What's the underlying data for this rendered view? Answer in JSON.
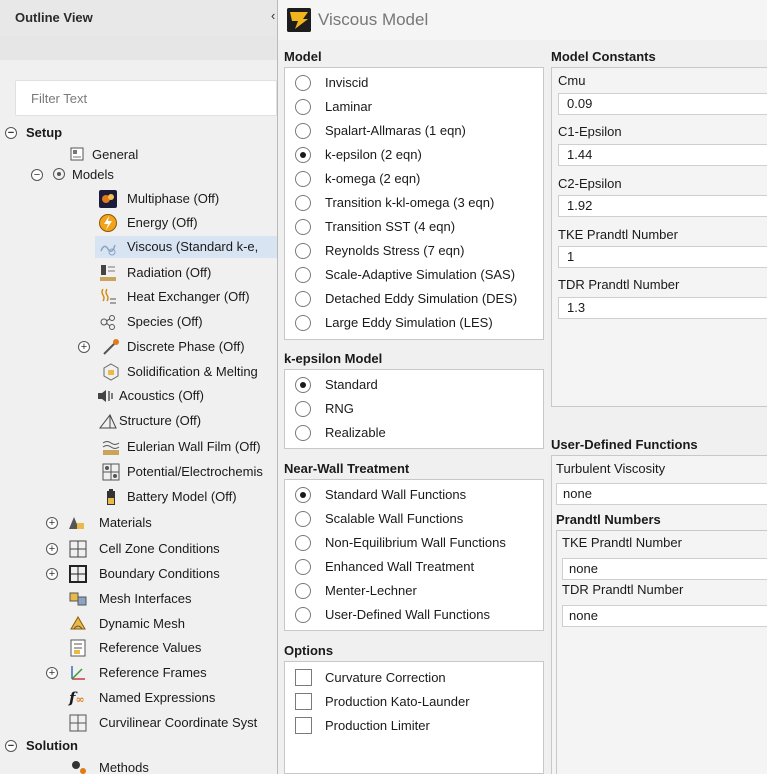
{
  "outline": {
    "title": "Outline View",
    "filter_placeholder": "Filter Text",
    "tree": {
      "setup": "Setup",
      "general": "General",
      "models": "Models",
      "multiphase": "Multiphase (Off)",
      "energy": "Energy (Off)",
      "viscous": "Viscous (Standard k-e,",
      "radiation": "Radiation (Off)",
      "heat_exchanger": "Heat Exchanger (Off)",
      "species": "Species (Off)",
      "discrete_phase": "Discrete Phase (Off)",
      "solidification": "Solidification & Melting",
      "acoustics": "Acoustics (Off)",
      "structure": "Structure (Off)",
      "eulerian": "Eulerian Wall Film (Off)",
      "potential": "Potential/Electrochemis",
      "battery": "Battery Model (Off)",
      "materials": "Materials",
      "cell_zone": "Cell Zone Conditions",
      "boundary": "Boundary Conditions",
      "mesh_interfaces": "Mesh Interfaces",
      "dynamic_mesh": "Dynamic Mesh",
      "reference_values": "Reference Values",
      "reference_frames": "Reference Frames",
      "named_expressions": "Named Expressions",
      "curvilinear": "Curvilinear Coordinate Syst",
      "solution": "Solution",
      "methods": "Methods"
    }
  },
  "dialog": {
    "title": "Viscous Model",
    "model": {
      "title": "Model",
      "options": [
        {
          "label": "Inviscid",
          "selected": false
        },
        {
          "label": "Laminar",
          "selected": false
        },
        {
          "label": "Spalart-Allmaras (1 eqn)",
          "selected": false
        },
        {
          "label": "k-epsilon (2 eqn)",
          "selected": true
        },
        {
          "label": "k-omega (2 eqn)",
          "selected": false
        },
        {
          "label": "Transition k-kl-omega (3 eqn)",
          "selected": false
        },
        {
          "label": "Transition SST (4 eqn)",
          "selected": false
        },
        {
          "label": "Reynolds Stress (7 eqn)",
          "selected": false
        },
        {
          "label": "Scale-Adaptive Simulation (SAS)",
          "selected": false
        },
        {
          "label": "Detached Eddy Simulation (DES)",
          "selected": false
        },
        {
          "label": "Large Eddy Simulation (LES)",
          "selected": false
        }
      ]
    },
    "kepsilon": {
      "title": "k-epsilon Model",
      "options": [
        {
          "label": "Standard",
          "selected": true
        },
        {
          "label": "RNG",
          "selected": false
        },
        {
          "label": "Realizable",
          "selected": false
        }
      ]
    },
    "nearwall": {
      "title": "Near-Wall Treatment",
      "options": [
        {
          "label": "Standard Wall Functions",
          "selected": true
        },
        {
          "label": "Scalable Wall Functions",
          "selected": false
        },
        {
          "label": "Non-Equilibrium Wall Functions",
          "selected": false
        },
        {
          "label": "Enhanced Wall Treatment",
          "selected": false
        },
        {
          "label": "Menter-Lechner",
          "selected": false
        },
        {
          "label": "User-Defined Wall Functions",
          "selected": false
        }
      ]
    },
    "options": {
      "title": "Options",
      "items": [
        {
          "label": "Curvature Correction",
          "checked": false
        },
        {
          "label": "Production Kato-Launder",
          "checked": false
        },
        {
          "label": "Production Limiter",
          "checked": false
        }
      ]
    },
    "constants": {
      "title": "Model Constants",
      "fields": [
        {
          "label": "Cmu",
          "value": "0.09"
        },
        {
          "label": "C1-Epsilon",
          "value": "1.44"
        },
        {
          "label": "C2-Epsilon",
          "value": "1.92"
        },
        {
          "label": "TKE Prandtl Number",
          "value": "1"
        },
        {
          "label": "TDR Prandtl Number",
          "value": "1.3"
        }
      ]
    },
    "udf": {
      "title": "User-Defined Functions",
      "turb_visc_label": "Turbulent Viscosity",
      "turb_visc_value": "none",
      "prandtl_title": "Prandtl Numbers",
      "tke_label": "TKE Prandtl Number",
      "tke_value": "none",
      "tdr_label": "TDR Prandtl Number",
      "tdr_value": "none"
    }
  }
}
